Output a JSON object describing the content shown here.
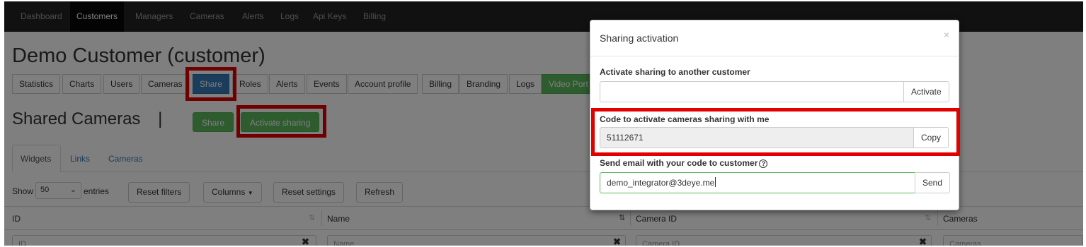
{
  "navbar": {
    "items": [
      "Dashboard",
      "Customers",
      "Managers",
      "Cameras",
      "Alerts",
      "Logs",
      "Api Keys",
      "Billing"
    ],
    "active": "Customers"
  },
  "page_title": "Demo Customer (customer)",
  "tabs": [
    "Statistics",
    "Charts",
    "Users",
    "Cameras",
    "Share",
    "Roles",
    "Alerts",
    "Events",
    "Account profile",
    "Billing",
    "Branding",
    "Logs",
    "Video Port"
  ],
  "active_tab": "Share",
  "section": {
    "title": "Shared Cameras",
    "divider": "|",
    "share_button": "Share",
    "activate_button": "Activate sharing"
  },
  "subtabs": [
    "Widgets",
    "Links",
    "Cameras"
  ],
  "filters": {
    "show_label": "Show",
    "entries_value": "50",
    "entries_label": "entries",
    "reset_filters": "Reset filters",
    "columns": "Columns",
    "reset_settings": "Reset settings",
    "refresh": "Refresh"
  },
  "table": {
    "columns": [
      "ID",
      "Name",
      "Camera ID",
      "Cameras"
    ],
    "filter_placeholders": [
      "ID",
      "Name",
      "Camera ID",
      "Cameras"
    ]
  },
  "modal": {
    "title": "Sharing activation",
    "close": "×",
    "activate_label": "Activate sharing to another customer",
    "activate_value": "",
    "activate_button": "Activate",
    "code_label": "Code to activate cameras sharing with me",
    "code_value": "51112671",
    "copy_button": "Copy",
    "email_label": "Send email with your code to customer",
    "help_icon": "?",
    "email_value": "demo_integrator@3deye.me",
    "send_button": "Send"
  },
  "colors": {
    "navbar": "#222222",
    "primary": "#337ab7",
    "success": "#5cb85c",
    "highlight": "#e10000"
  }
}
